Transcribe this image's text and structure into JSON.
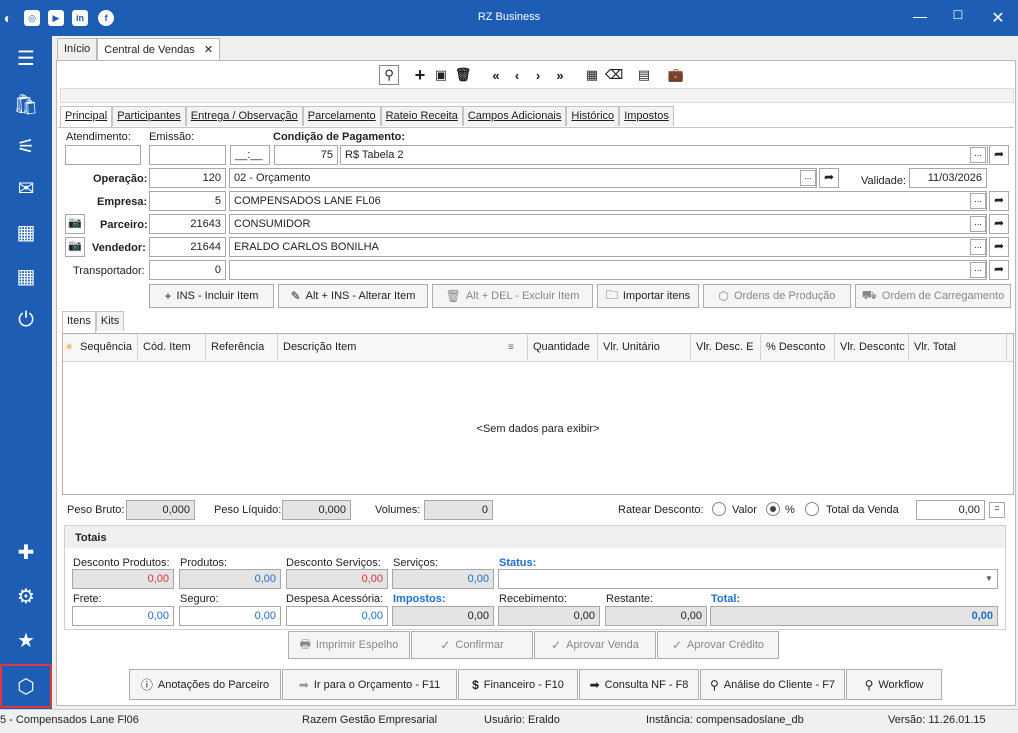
{
  "window": {
    "title": "RZ Business"
  },
  "social": [
    "instagram-icon",
    "youtube-icon",
    "linkedin-icon",
    "facebook-icon"
  ],
  "tabs": [
    {
      "label": "Início"
    },
    {
      "label": "Central de Vendas"
    }
  ],
  "content_tabs": [
    "Principal",
    "Participantes",
    "Entrega / Observação",
    "Parcelamento",
    "Rateio Receita",
    "Campos Adicionais",
    "Histórico",
    "Impostos"
  ],
  "header": {
    "atendimento_label": "Atendimento:",
    "emissao_label": "Emissão:",
    "condicao_label": "Condição de Pagamento:",
    "time_value": "__:__",
    "condicao_code": "75",
    "condicao_desc": "R$ Tabela 2",
    "operacao_label": "Operação:",
    "operacao_code": "120",
    "operacao_desc": "02 - Orçamento",
    "validade_label": "Validade:",
    "validade_value": "11/03/2026",
    "empresa_label": "Empresa:",
    "empresa_code": "5",
    "empresa_desc": "COMPENSADOS LANE FL06",
    "parceiro_label": "Parceiro:",
    "parceiro_code": "21643",
    "parceiro_desc": "CONSUMIDOR",
    "vendedor_label": "Vendedor:",
    "vendedor_code": "21644",
    "vendedor_desc": "ERALDO CARLOS BONILHA",
    "transportador_label": "Transportador:",
    "transportador_code": "0"
  },
  "item_buttons": {
    "incluir": "INS - Incluir Item",
    "alterar": "Alt + INS - Alterar Item",
    "excluir": "Alt + DEL - Excluir Item",
    "importar": "Importar itens",
    "ordens": "Ordens de Produção",
    "carregamento": "Ordem de Carregamento"
  },
  "grid_tabs": [
    "Itens",
    "Kits"
  ],
  "grid": {
    "columns": [
      "Sequência",
      "Cód. Item",
      "Referência",
      "Descrição Item",
      "Quantidade",
      "Vlr. Unitário",
      "Vlr. Desc. E",
      "% Desconto",
      "Vlr. Descontc",
      "Vlr. Total"
    ],
    "empty": "<Sem dados para exibir>"
  },
  "weights": {
    "peso_bruto_label": "Peso Bruto:",
    "peso_bruto": "0,000",
    "peso_liquido_label": "Peso Líquido:",
    "peso_liquido": "0,000",
    "volumes_label": "Volumes:",
    "volumes": "0",
    "ratear_label": "Ratear Desconto:",
    "opt_valor": "Valor",
    "opt_pct": "%",
    "opt_total": "Total da Venda",
    "desconto": "0,00",
    "eq": "="
  },
  "totais": {
    "title": "Totais",
    "desc_produtos_label": "Desconto Produtos:",
    "desc_produtos": "0,00",
    "produtos_label": "Produtos:",
    "produtos": "0,00",
    "desc_servicos_label": "Desconto Serviços:",
    "desc_servicos": "0,00",
    "servicos_label": "Serviços:",
    "servicos": "0,00",
    "status_label": "Status:",
    "frete_label": "Frete:",
    "frete": "0,00",
    "seguro_label": "Seguro:",
    "seguro": "0,00",
    "despesa_label": "Despesa Acessória:",
    "despesa": "0,00",
    "impostos_label": "Impostos:",
    "impostos": "0,00",
    "recebimento_label": "Recebimento:",
    "recebimento": "0,00",
    "restante_label": "Restante:",
    "restante": "0,00",
    "total_label": "Total:",
    "total": "0,00"
  },
  "actions": {
    "imprimir": "Imprimir Espelho",
    "confirmar": "Confirmar",
    "aprovar_venda": "Aprovar Venda",
    "aprovar_credito": "Aprovar Crédito"
  },
  "bottom": {
    "anotacoes": "Anotações do Parceiro",
    "orcamento": "Ir para o Orçamento - F11",
    "financeiro": "Financeiro - F10",
    "consulta": "Consulta NF - F8",
    "analise": "Análise do Cliente - F7",
    "workflow": "Workflow"
  },
  "statusbar": {
    "empresa": "5 - Compensados Lane Fl06",
    "sistema": "Razem Gestão Empresarial",
    "usuario": "Usuário: Eraldo",
    "instancia": "Instância: compensadoslane_db",
    "versao": "Versão: 11.26.01.15"
  },
  "colors": {
    "primary": "#1d5db3",
    "highlight": "#e03030",
    "label_blue": "#1f6ec7"
  }
}
